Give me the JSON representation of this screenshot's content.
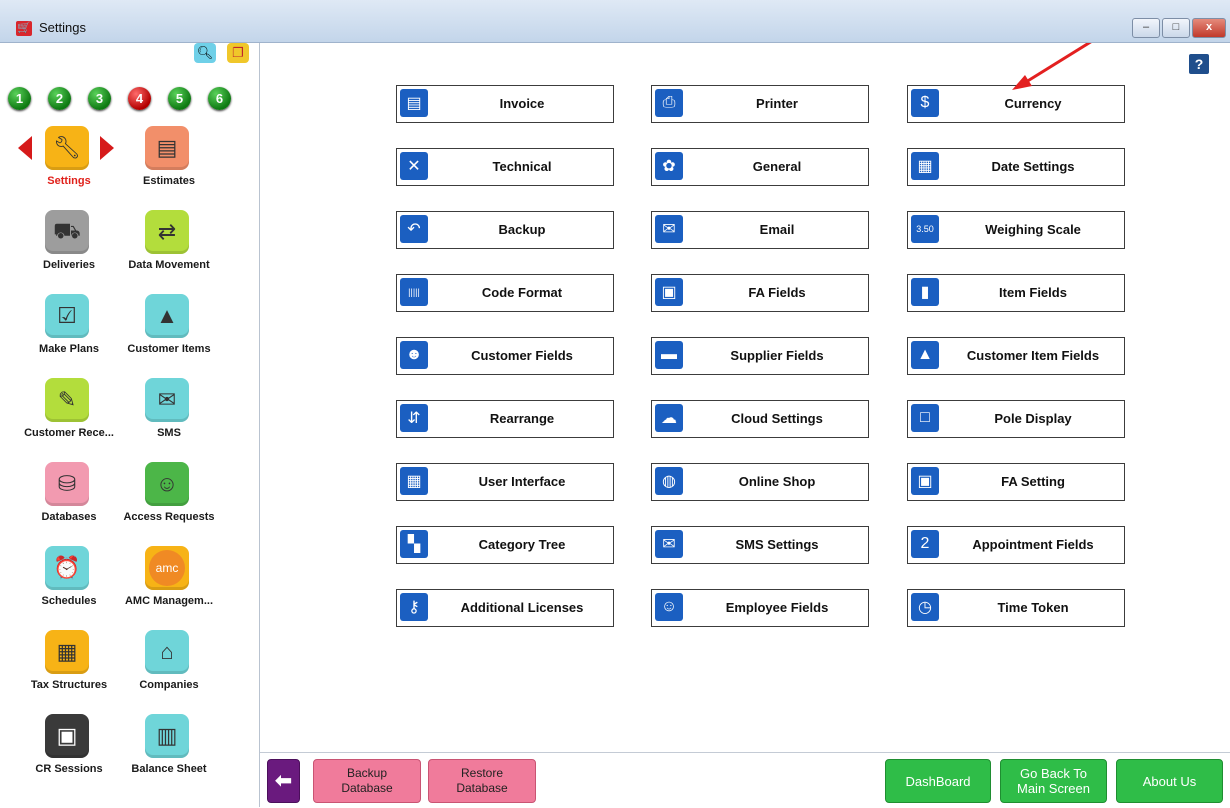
{
  "window": {
    "title": "Settings",
    "controls": {
      "minimize": "–",
      "maximize": "□",
      "close": "x"
    }
  },
  "toolbar": {
    "search_icon": "search-icon",
    "window_icon": "windows-icon"
  },
  "pages": [
    "1",
    "2",
    "3",
    "4",
    "5",
    "6"
  ],
  "active_page": "4",
  "left_nav": [
    {
      "label": "Settings",
      "icon": "wrench-icon",
      "color": "#f7b316",
      "selected": true
    },
    {
      "label": "Estimates",
      "icon": "document-check-icon",
      "color": "#f28f6a"
    },
    {
      "label": "Deliveries",
      "icon": "truck-icon",
      "color": "#9d9d9d"
    },
    {
      "label": "Data Movement",
      "icon": "data-move-icon",
      "color": "#b3dd3c"
    },
    {
      "label": "Make Plans",
      "icon": "checklist-icon",
      "color": "#6fd5d9"
    },
    {
      "label": "Customer Items",
      "icon": "shapes-icon",
      "color": "#6fd5d9"
    },
    {
      "label": "Customer Rece...",
      "icon": "receipt-icon",
      "color": "#b3dd3c"
    },
    {
      "label": "SMS",
      "icon": "sms-icon",
      "color": "#6fd5d9"
    },
    {
      "label": "Databases",
      "icon": "database-icon",
      "color": "#f29ab0"
    },
    {
      "label": "Access Requests",
      "icon": "user-lock-icon",
      "color": "#4cb648"
    },
    {
      "label": "Schedules",
      "icon": "alarm-clock-icon",
      "color": "#6fd5d9"
    },
    {
      "label": "AMC Managem...",
      "icon": "amc-icon",
      "color": "#f7b316"
    },
    {
      "label": "Tax Structures",
      "icon": "hierarchy-icon",
      "color": "#f7b316"
    },
    {
      "label": "Companies",
      "icon": "house-icon",
      "color": "#6fd5d9"
    },
    {
      "label": "CR Sessions",
      "icon": "register-icon",
      "color": "#3a3a3a"
    },
    {
      "label": "Balance Sheet",
      "icon": "bar-chart-icon",
      "color": "#6fd5d9"
    }
  ],
  "amc_text": "amc",
  "help": "?",
  "tiles": [
    {
      "label": "Invoice",
      "icon": "invoice-icon",
      "glyph": "▤"
    },
    {
      "label": "Printer",
      "icon": "printer-icon",
      "glyph": "⎙"
    },
    {
      "label": "Currency",
      "icon": "currency-icon",
      "glyph": "$"
    },
    {
      "label": "Technical",
      "icon": "tools-icon",
      "glyph": "✕"
    },
    {
      "label": "General",
      "icon": "gear-icon",
      "glyph": "✿"
    },
    {
      "label": "Date Settings",
      "icon": "calendar-clock-icon",
      "glyph": "▦"
    },
    {
      "label": "Backup",
      "icon": "backup-icon",
      "glyph": "↶"
    },
    {
      "label": "Email",
      "icon": "envelope-icon",
      "glyph": "✉"
    },
    {
      "label": "Weighing Scale",
      "icon": "scale-icon",
      "glyph": "3.50"
    },
    {
      "label": "Code Format",
      "icon": "barcode-icon",
      "glyph": "|||||"
    },
    {
      "label": "FA Fields",
      "icon": "coins-icon",
      "glyph": "▣"
    },
    {
      "label": "Item Fields",
      "icon": "items-icon",
      "glyph": "▮"
    },
    {
      "label": "Customer Fields",
      "icon": "customers-icon",
      "glyph": "☻"
    },
    {
      "label": "Supplier Fields",
      "icon": "truck-icon",
      "glyph": "▬"
    },
    {
      "label": "Customer Item Fields",
      "icon": "shapes-icon",
      "glyph": "▲"
    },
    {
      "label": "Rearrange",
      "icon": "rearrange-icon",
      "glyph": "⇵"
    },
    {
      "label": "Cloud Settings",
      "icon": "cloud-icon",
      "glyph": "☁"
    },
    {
      "label": "Pole Display",
      "icon": "display-icon",
      "glyph": "□"
    },
    {
      "label": "User Interface",
      "icon": "grid-icon",
      "glyph": "▦"
    },
    {
      "label": "Online Shop",
      "icon": "globe-icon",
      "glyph": "◍"
    },
    {
      "label": "FA Setting",
      "icon": "coins-icon",
      "glyph": "▣"
    },
    {
      "label": "Category Tree",
      "icon": "tree-icon",
      "glyph": "▚"
    },
    {
      "label": "SMS Settings",
      "icon": "sms-icon",
      "glyph": "✉"
    },
    {
      "label": "Appointment Fields",
      "icon": "calendar-icon",
      "glyph": "2"
    },
    {
      "label": "Additional Licenses",
      "icon": "key-icon",
      "glyph": "⚷"
    },
    {
      "label": "Employee Fields",
      "icon": "employee-icon",
      "glyph": "☺"
    },
    {
      "label": "Time Token",
      "icon": "clock-icon",
      "glyph": "◷"
    }
  ],
  "bottom_buttons": {
    "back_glyph": "⬅",
    "backup": "Backup Database",
    "restore": "Restore Database",
    "dashboard": "DashBoard",
    "go_back": "Go Back To Main Screen",
    "about": "About Us"
  },
  "colors": {
    "tile_icon_bg": "#1b5fc1",
    "pink_button": "#f07b9b",
    "green_button": "#2fbd48",
    "back_button": "#6a1a7e",
    "annotation_arrow": "#e32020"
  }
}
